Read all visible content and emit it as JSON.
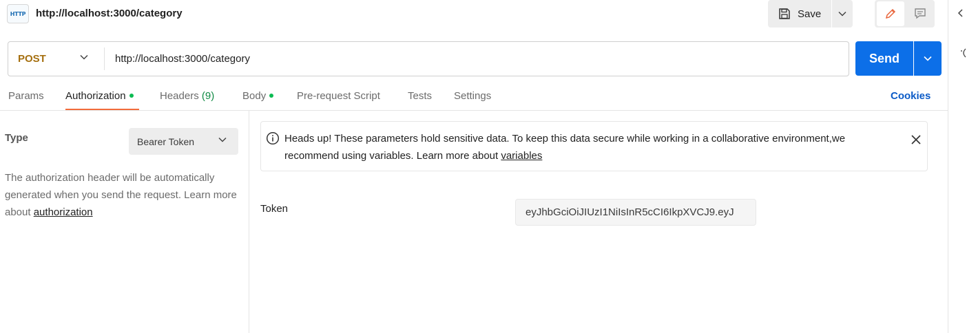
{
  "request": {
    "title": "http://localhost:3000/category",
    "type_icon_text": "HTTP"
  },
  "toolbar": {
    "save_label": "Save"
  },
  "url_bar": {
    "method": "POST",
    "url": "http://localhost:3000/category",
    "send_label": "Send"
  },
  "tabs": [
    {
      "label": "Params",
      "active": false
    },
    {
      "label": "Authorization",
      "active": true,
      "indicator": true
    },
    {
      "label": "Headers",
      "count": "(9)"
    },
    {
      "label": "Body",
      "indicator": true
    },
    {
      "label": "Pre-request Script"
    },
    {
      "label": "Tests"
    },
    {
      "label": "Settings"
    }
  ],
  "cookies_label": "Cookies",
  "auth": {
    "type_label": "Type",
    "type_value": "Bearer Token",
    "description": "The authorization header will be automatically generated when you send the request. Learn more about",
    "description_link": "authorization",
    "alert_text": "Heads up! These parameters hold sensitive data. To keep this data secure while working in a collaborative environment,we recommend using variables. Learn more about",
    "alert_link": "variables",
    "token_label": "Token",
    "token_value": "eyJhbGciOiJIUzI1NiIsInR5cCI6IkpXVCJ9.eyJ"
  },
  "colors": {
    "accent_send": "#0c6fe8",
    "method_post": "#a56f0f",
    "tab_active_underline": "#f26b3a",
    "indicator_dot": "#0cbb52",
    "cookies_link": "#0b5bc7"
  }
}
